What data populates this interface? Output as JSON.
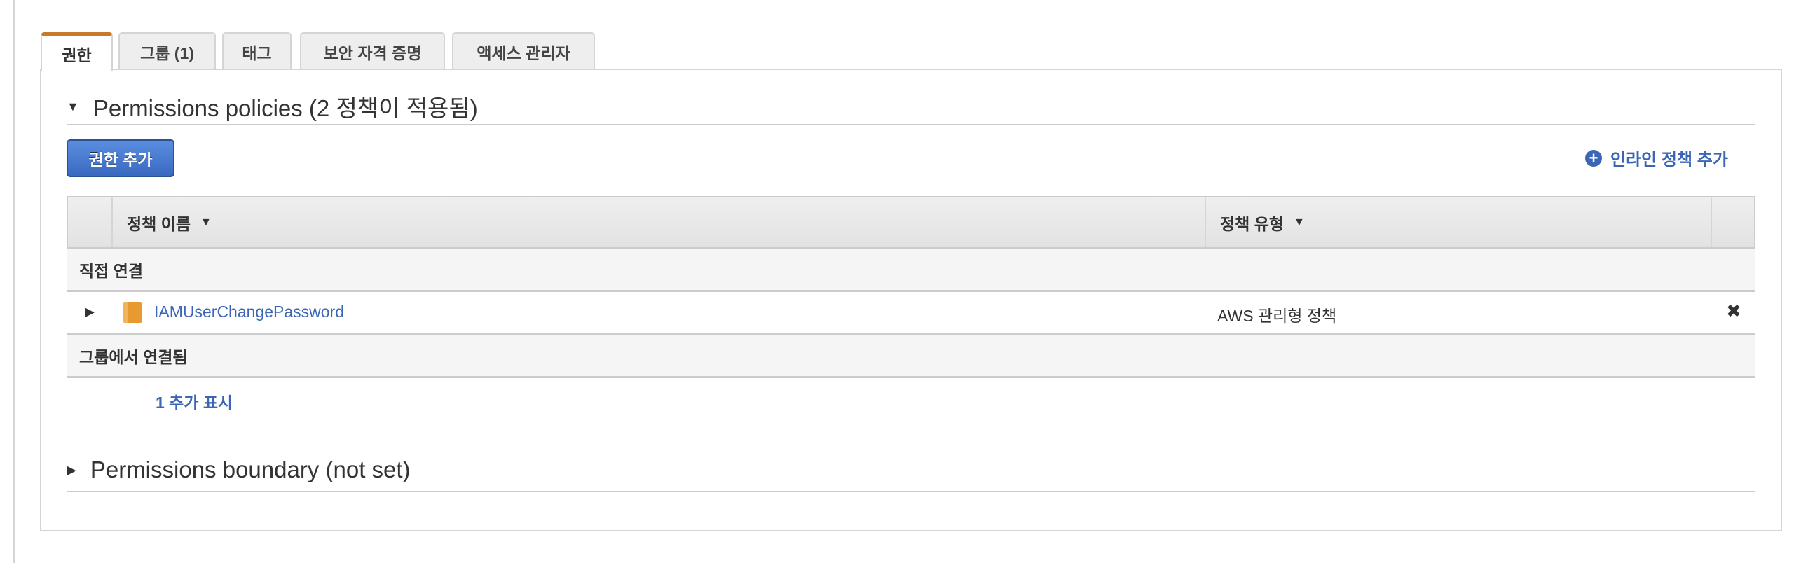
{
  "tabs": [
    {
      "label": "권한",
      "active": true
    },
    {
      "label": "그룹 (1)"
    },
    {
      "label": "태그"
    },
    {
      "label": "보안 자격 증명"
    },
    {
      "label": "액세스 관리자"
    }
  ],
  "permissions": {
    "heading": "Permissions policies (2 정책이 적용됨)",
    "add_button": "권한 추가",
    "inline_policy_link": "인라인 정책 추가",
    "columns": [
      "정책 이름",
      "정책 유형"
    ],
    "direct_section": "직접 연결",
    "policies": [
      {
        "name": "IAMUserChangePassword",
        "type": "AWS 관리형 정책"
      }
    ],
    "group_section": "그룹에서 연결됨",
    "show_more": "1 추가 표시"
  },
  "boundary": {
    "heading": "Permissions boundary (not set)"
  },
  "colors": {
    "accent_tab": "#c9792b",
    "link": "#3a66b5",
    "button": "#3a6ac0",
    "policy_icon": "#e89a30"
  }
}
